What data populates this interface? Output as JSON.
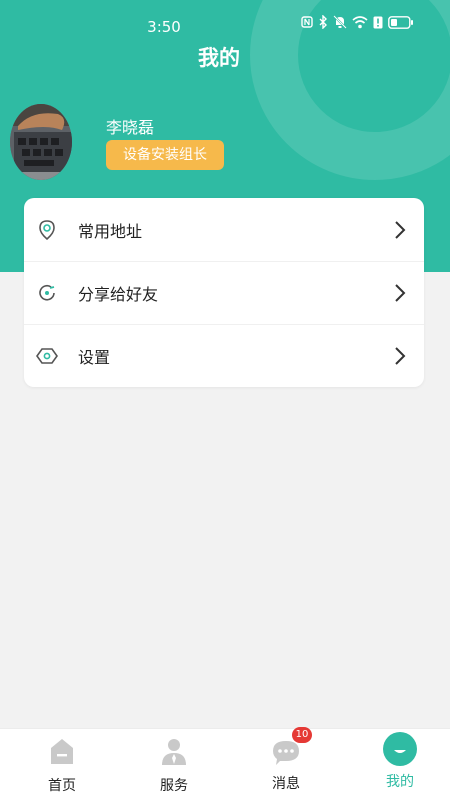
{
  "status_bar": {
    "time": "3:50"
  },
  "header": {
    "title": "我的"
  },
  "profile": {
    "name": "李晓磊",
    "role": "设备安装组长"
  },
  "menu": {
    "items": [
      {
        "label": "常用地址",
        "icon": "location-pin-icon"
      },
      {
        "label": "分享给好友",
        "icon": "share-refresh-icon"
      },
      {
        "label": "设置",
        "icon": "settings-hex-icon"
      }
    ]
  },
  "tabbar": {
    "items": [
      {
        "label": "首页",
        "icon": "home-icon"
      },
      {
        "label": "服务",
        "icon": "person-icon"
      },
      {
        "label": "消息",
        "icon": "message-icon",
        "badge": "10"
      },
      {
        "label": "我的",
        "icon": "profile-icon",
        "active": true
      }
    ]
  },
  "colors": {
    "primary": "#2fbba3",
    "badge": "#f6b94b",
    "unread": "#e53935",
    "background": "#f2f2f2"
  }
}
